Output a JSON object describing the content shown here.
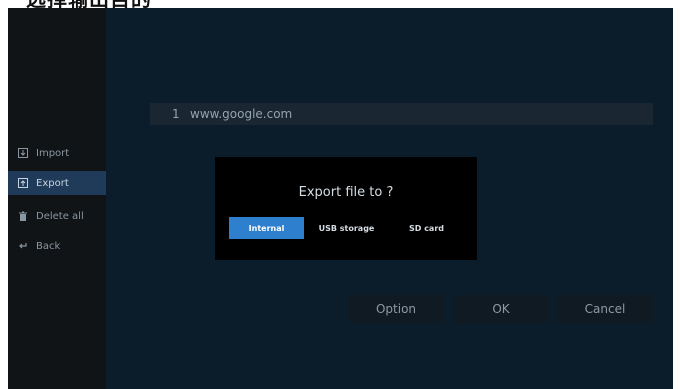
{
  "page_heading": "选择输出目的",
  "sidebar": {
    "items": [
      {
        "label": "Import",
        "icon": "import-icon"
      },
      {
        "label": "Export",
        "icon": "export-icon",
        "selected": true
      },
      {
        "label": "Delete all",
        "icon": "trash-icon"
      },
      {
        "label": "Back",
        "icon": "back-icon"
      }
    ]
  },
  "list": {
    "rows": [
      {
        "index": "1",
        "url": "www.google.com"
      }
    ]
  },
  "dialog": {
    "title": "Export file to ?",
    "options": [
      {
        "label": "Internal",
        "selected": true
      },
      {
        "label": "USB storage",
        "selected": false
      },
      {
        "label": "SD card",
        "selected": false
      }
    ]
  },
  "buttons": {
    "option": "Option",
    "ok": "OK",
    "cancel": "Cancel"
  },
  "colors": {
    "background": "#0b1d2b",
    "sidebar": "#111417",
    "selected": "#1f3b59",
    "accent": "#2f7fcf",
    "dialog": "#000000"
  }
}
